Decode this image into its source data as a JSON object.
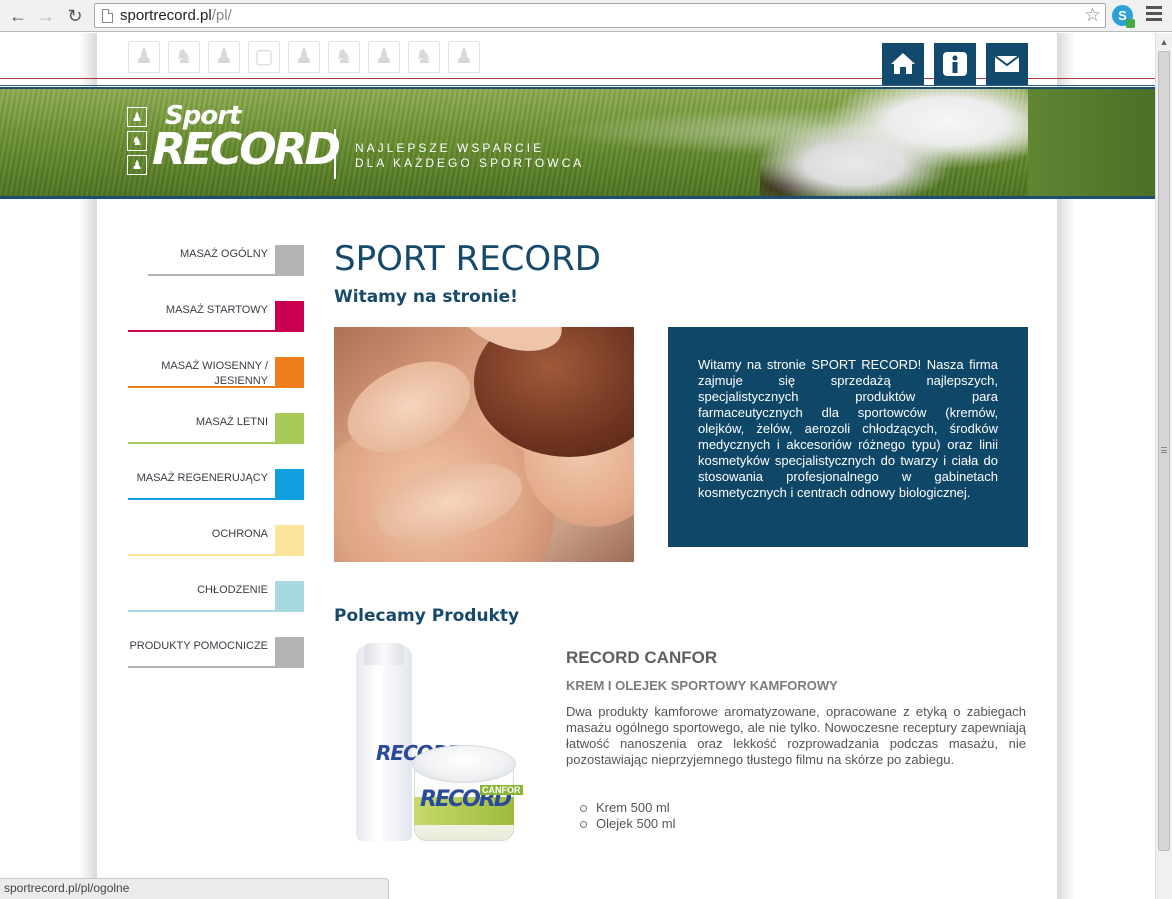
{
  "browser": {
    "url_host": "sportrecord.pl",
    "url_path": "/pl/",
    "status_url": "sportrecord.pl/pl/ogolne"
  },
  "header": {
    "logo_sport": "Sport",
    "logo_record": "RECORD",
    "slogan_line1": "NAJLEPSZE WSPARCIE",
    "slogan_line2": "DLA KAŻDEGO SPORTOWCA",
    "icon_buttons": [
      "home-icon",
      "info-icon",
      "mail-icon"
    ]
  },
  "sidebar": {
    "items": [
      {
        "label": "MASAŻ OGÓLNY",
        "color": "#b3b3b3",
        "line": "#b3b3b3"
      },
      {
        "label": "MASAŻ STARTOWY",
        "color": "#c8004f",
        "line": "#c8004f"
      },
      {
        "label": "MASAŻ WIOSENNY / JESIENNY",
        "color": "#ee7d1b",
        "line": "#ee7d1b"
      },
      {
        "label": "MASAŻ LETNI",
        "color": "#a7c957",
        "line": "#a7c957"
      },
      {
        "label": "MASAŻ REGENERUJĄCY",
        "color": "#10a0e0",
        "line": "#10a0e0"
      },
      {
        "label": "OCHRONA",
        "color": "#fbe59b",
        "line": "#fbe59b"
      },
      {
        "label": "CHŁODZENIE",
        "color": "#a9d9e0",
        "line": "#a9d9e0"
      },
      {
        "label": "PRODUKTY POMOCNICZE",
        "color": "#b3b3b3",
        "line": "#b3b3b3"
      }
    ]
  },
  "main": {
    "title": "SPORT RECORD",
    "subtitle": "Witamy na stronie!",
    "intro_text": "Witamy na stronie SPORT RECORD! Nasza firma zajmuje się sprzedażą najlepszych, specjalistycznych produktów para farmaceutycznych dla sportowców (kremów, olejków, żelów, aerozoli chłodzących, środków medycznych i akcesoriów różnego typu) oraz linii kosmetyków specjalistycznych do twarzy i ciała do stosowania profesjonalnego w gabinetach kosmetycznych i centrach odnowy biologicznej.",
    "products_heading": "Polecamy Produkty",
    "product": {
      "name": "RECORD CANFOR",
      "subtitle": "KREM I OLEJEK SPORTOWY KAMFOROWY",
      "description": "Dwa produkty kamforowe aromatyzowane, opracowane z etyką o zabiegach masażu ogólnego sportowego, ale nie tylko. Nowoczesne receptury zapewniają łatwość nanoszenia oraz lekkość rozprowadzania podczas masażu, nie pozostawiając nieprzyjemnego tłustego filmu na skórze po zabiegu.",
      "variants": [
        "Krem 500 ml",
        "Olejek 500 ml"
      ],
      "bottle_label": "RECORD",
      "jar_label": "RECORD",
      "jar_badge": "CANFOR"
    }
  },
  "colors": {
    "brand_blue": "#0e4768",
    "title_blue": "#17496b"
  }
}
